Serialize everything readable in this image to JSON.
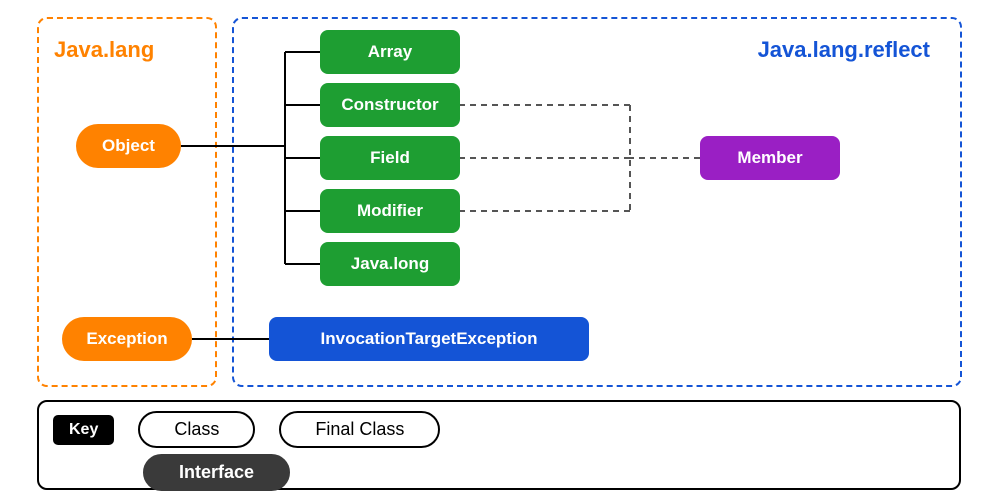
{
  "packages": {
    "lang": "Java.lang",
    "reflect": "Java.lang.reflect"
  },
  "nodes": {
    "object": "Object",
    "exception": "Exception",
    "array": "Array",
    "constructor": "Constructor",
    "field": "Field",
    "modifier": "Modifier",
    "javalong": "Java.long",
    "invocation": "InvocationTargetException",
    "member": "Member"
  },
  "legend": {
    "key": "Key",
    "class": "Class",
    "final_class": "Final Class",
    "interface": "Interface"
  },
  "colors": {
    "orange": "#ff8200",
    "green": "#1e9e32",
    "blue": "#1454d6",
    "purple": "#9a1fc4",
    "dark": "#3a3a3a"
  },
  "edges": {
    "solid_from_object_to": [
      "array",
      "constructor",
      "field",
      "modifier",
      "javalong"
    ],
    "solid_from_exception_to": [
      "invocation"
    ],
    "dashed_from_member_to": [
      "constructor",
      "field",
      "modifier"
    ]
  }
}
